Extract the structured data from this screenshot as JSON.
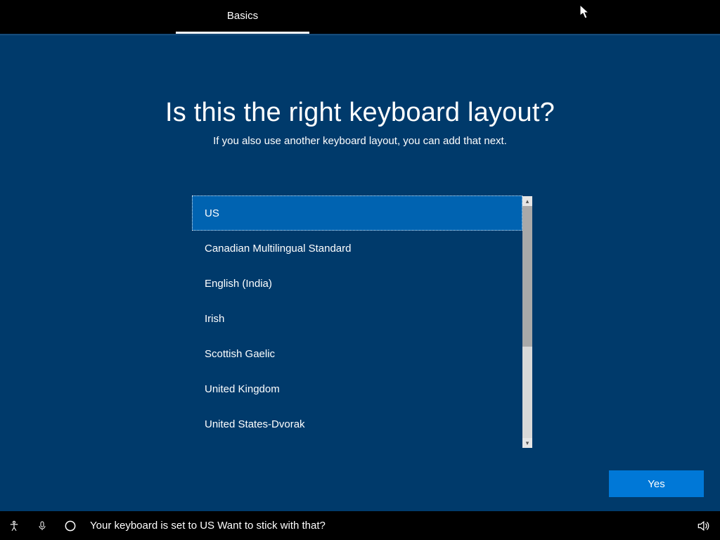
{
  "topbar": {
    "tab_label": "Basics"
  },
  "heading": "Is this the right keyboard layout?",
  "subheading": "If you also use another keyboard layout, you can add that next.",
  "keyboard_layouts": {
    "selected_index": 0,
    "items": [
      "US",
      "Canadian Multilingual Standard",
      "English (India)",
      "Irish",
      "Scottish Gaelic",
      "United Kingdom",
      "United States-Dvorak"
    ]
  },
  "yes_button_label": "Yes",
  "bottombar": {
    "status_text": "Your keyboard is set to US Want to stick with that?"
  },
  "icons": {
    "accessibility": "accessibility-icon",
    "microphone": "microphone-icon",
    "cortana": "cortana-circle-icon",
    "volume": "volume-icon",
    "scroll_up": "▴",
    "scroll_down": "▾"
  },
  "colors": {
    "background": "#003a6b",
    "selected": "#0063b1",
    "accent_button": "#0078d7",
    "black": "#000000"
  }
}
